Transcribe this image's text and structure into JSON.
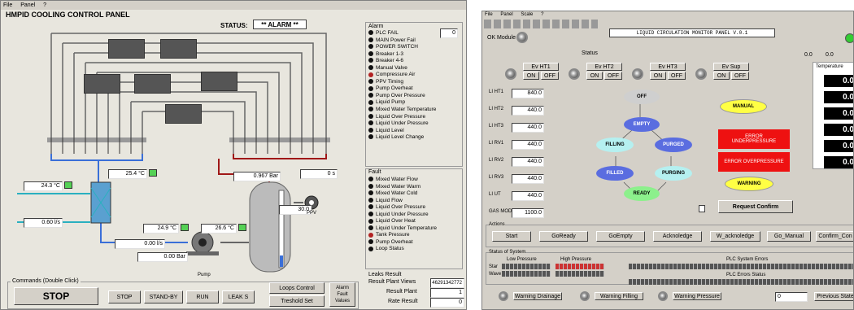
{
  "left": {
    "menu": [
      "File",
      "Panel",
      "?"
    ],
    "title": "HMPID COOLING CONTROL PANEL",
    "status_label": "STATUS:",
    "status_value": "** ALARM **",
    "alarm_header": "Alarm",
    "alarm_box": "0",
    "alarms": [
      {
        "text": "PLC FAIL",
        "state": "off"
      },
      {
        "text": "MAIN Power Fail",
        "state": "off"
      },
      {
        "text": "POWER SWITCH",
        "state": "off"
      },
      {
        "text": "Breaker 1-3",
        "state": "off"
      },
      {
        "text": "Breaker 4-6",
        "state": "off"
      },
      {
        "text": "Manual Valve",
        "state": "off"
      },
      {
        "text": "Compressure Air",
        "state": "on"
      },
      {
        "text": "PPV Timing",
        "state": "off"
      },
      {
        "text": "Pump Overheat",
        "state": "off"
      },
      {
        "text": "Pump Over Pressure",
        "state": "off"
      },
      {
        "text": "Liquid Pump",
        "state": "off"
      },
      {
        "text": "Mixed Water Temperature",
        "state": "off"
      },
      {
        "text": "Liquid Over Pressure",
        "state": "off"
      },
      {
        "text": "Liquid Under Pressure",
        "state": "off"
      },
      {
        "text": "Liquid Level",
        "state": "off"
      },
      {
        "text": "Liquid Level Change",
        "state": "off"
      }
    ],
    "fault_header": "Fault",
    "faults": [
      {
        "text": "Mixed Water Flow",
        "state": "off"
      },
      {
        "text": "Mixed Water Warm",
        "state": "off"
      },
      {
        "text": "Mixed Water Cold",
        "state": "off"
      },
      {
        "text": "Liquid Flow",
        "state": "off"
      },
      {
        "text": "Liquid Over Pressure",
        "state": "off"
      },
      {
        "text": "Liquid Under Pressure",
        "state": "off"
      },
      {
        "text": "Liquid Over Heat",
        "state": "off"
      },
      {
        "text": "Liquid Under Temperature",
        "state": "off"
      },
      {
        "text": "Tank Pressure",
        "state": "on"
      },
      {
        "text": "Pump Overheat",
        "state": "off"
      },
      {
        "text": "Loop Status",
        "state": "off"
      }
    ],
    "leaks_header": "Leaks Result",
    "leaks": [
      {
        "label": "Result Plant Views",
        "value": "46291342772"
      },
      {
        "label": "Result Plant",
        "value": "1"
      },
      {
        "label": "Rate Result",
        "value": "0"
      }
    ],
    "readings": {
      "t1": "25.4 °C",
      "t2": "24.3 °C",
      "flow1": "0.60 l/s",
      "t3": "24.9 °C",
      "t4": "26.6 °C",
      "flow2": "0.00 l/s",
      "pres1": "0.00 Bar",
      "tank_pres": "0.967 Bar",
      "ppv_time": "0 s",
      "level": "30.0"
    },
    "ppv_label": "PPV",
    "pump_label": "Pump",
    "commands_label": "Commands (Double Click)",
    "buttons": {
      "stop_big": "STOP",
      "stop": "STOP",
      "standby": "STAND-BY",
      "run": "RUN",
      "leaks": "LEAK S",
      "loops": "Loops Control",
      "treshold": "Treshold Set",
      "alarm_fault": "Alarm Fault Values"
    }
  },
  "right": {
    "menu": [
      "File",
      "Panel",
      "Scale",
      "?"
    ],
    "title": "LIQUID CIRCULATION MONITOR PANEL V.0.1",
    "ok_module": "OK Module",
    "status_label": "Status",
    "status_values": [
      "0.0",
      "0.0"
    ],
    "temp_header": "Temperature",
    "temps": [
      "0.0",
      "0.0",
      "0.0",
      "0.0",
      "0.0",
      "0.0"
    ],
    "ev_groups": [
      {
        "name": "Ev HT1",
        "on": "ON",
        "off": "OFF"
      },
      {
        "name": "Ev HT2",
        "on": "ON",
        "off": "OFF"
      },
      {
        "name": "Ev HT3",
        "on": "ON",
        "off": "OFF"
      },
      {
        "name": "Ev Sup",
        "on": "ON",
        "off": "OFF"
      }
    ],
    "levels": [
      {
        "label": "LI HT1",
        "value": "840.0"
      },
      {
        "label": "LI HT2",
        "value": "440.0"
      },
      {
        "label": "LI HT3",
        "value": "440.0"
      },
      {
        "label": "LI RV1",
        "value": "440.0"
      },
      {
        "label": "LI RV2",
        "value": "440.0"
      },
      {
        "label": "LI RV3",
        "value": "440.0"
      },
      {
        "label": "LI UT",
        "value": "440.0"
      },
      {
        "label": "GAS MOD",
        "value": "1100.0"
      }
    ],
    "states": {
      "off": "OFF",
      "empty": "EMPTY",
      "filling": "FILLING",
      "purged": "PURGED",
      "filled": "FILLED",
      "purging": "PURGING",
      "ready": "READY"
    },
    "manual": "MANUAL",
    "error1": "ERROR UNDERPRESSURE",
    "error2": "ERROR OVERPRESSURE",
    "warning": "WARNING",
    "request": "Request Confirm",
    "actions_label": "Actions",
    "actions": [
      "Start",
      "GoReady",
      "GoEmpty",
      "Acknoledge",
      "W_acknoledge",
      "Go_Manual",
      "Confirm_Con"
    ],
    "status_system": "Status of System",
    "low_pressure": "Low Pressure",
    "high_pressure": "High Pressure",
    "plc_errors": "PLC System Errors",
    "plc_errors_status": "PLC Errors Status",
    "row1": "Star",
    "row2": "Wave",
    "bottom": {
      "w1": "Warning Drainage",
      "w2": "Warning Filling",
      "w3": "Warning Pressure",
      "prev": "Previous State",
      "field": "0"
    }
  }
}
